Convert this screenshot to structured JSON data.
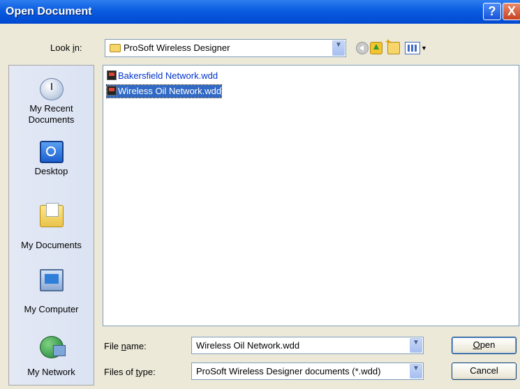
{
  "window": {
    "title": "Open Document",
    "help_glyph": "?",
    "close_glyph": "X"
  },
  "lookin": {
    "label": "Look in:",
    "value": "ProSoft Wireless Designer"
  },
  "toolbar": {
    "icons": [
      "back-icon",
      "up-folder-icon",
      "new-folder-icon",
      "views-menu-icon"
    ]
  },
  "places": [
    {
      "label": "My Recent Documents",
      "icon": "recent-documents-icon"
    },
    {
      "label": "Desktop",
      "icon": "desktop-icon"
    },
    {
      "label": "My Documents",
      "icon": "my-documents-icon"
    },
    {
      "label": "My Computer",
      "icon": "my-computer-icon"
    },
    {
      "label": "My Network",
      "icon": "my-network-icon"
    }
  ],
  "files": [
    {
      "name": "Bakersfield Network.wdd",
      "selected": false
    },
    {
      "name": "Wireless Oil Network.wdd",
      "selected": true
    }
  ],
  "filename": {
    "label": "File name:",
    "value": "Wireless Oil Network.wdd"
  },
  "filetype": {
    "label": "Files of type:",
    "value": "ProSoft Wireless Designer documents (*.wdd)"
  },
  "buttons": {
    "open": "Open",
    "cancel": "Cancel"
  },
  "colors": {
    "title_bar": "#0a5ce0",
    "selection": "#316ac5",
    "dialog_bg": "#ece9d8",
    "link_text": "#0033cc"
  }
}
